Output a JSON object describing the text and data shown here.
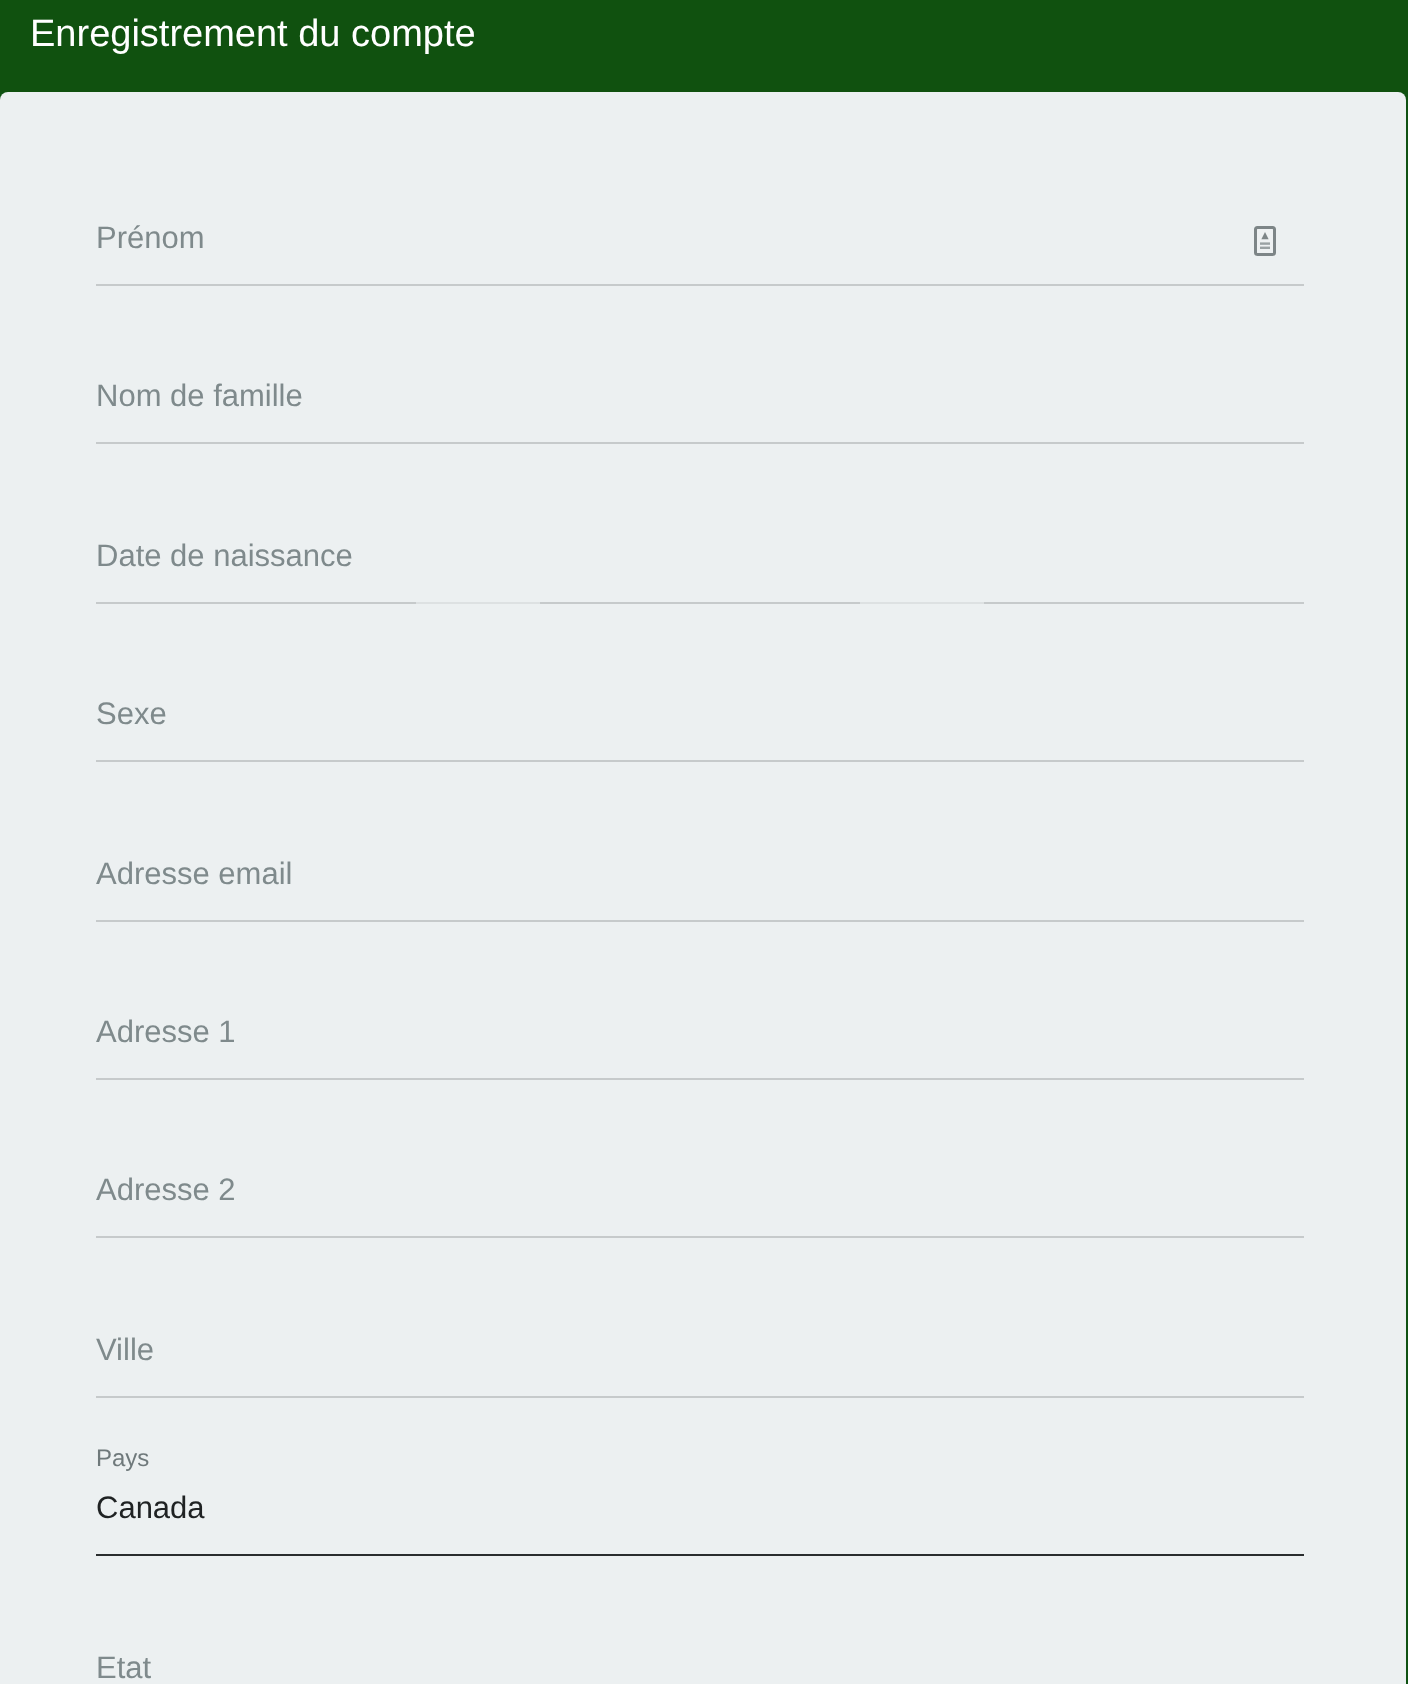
{
  "header": {
    "title": "Enregistrement du compte"
  },
  "fields": [
    {
      "kind": "text",
      "placeholder": "Prénom",
      "autofill": true
    },
    {
      "kind": "text",
      "placeholder": "Nom de famille",
      "autofill": false
    },
    {
      "kind": "date",
      "placeholder": "Date de naissance",
      "autofill": false
    },
    {
      "kind": "text",
      "placeholder": "Sexe",
      "autofill": false
    },
    {
      "kind": "text",
      "placeholder": "Adresse email",
      "autofill": false
    },
    {
      "kind": "text",
      "placeholder": "Adresse 1",
      "autofill": false
    },
    {
      "kind": "text",
      "placeholder": "Adresse 2",
      "autofill": false
    },
    {
      "kind": "text",
      "placeholder": "Ville",
      "autofill": false
    },
    {
      "kind": "filled",
      "label": "Pays",
      "value": "Canada",
      "autofill": false
    },
    {
      "kind": "text",
      "placeholder": "Etat",
      "autofill": false
    }
  ]
}
